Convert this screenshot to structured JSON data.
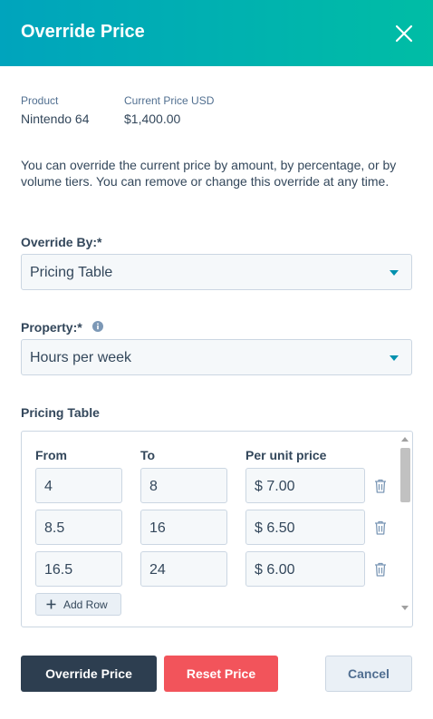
{
  "dialog": {
    "title": "Override Price",
    "close_icon": "close-icon"
  },
  "product": {
    "label": "Product",
    "value": "Nintendo 64",
    "price_label": "Current Price USD",
    "price_value": "$1,400.00"
  },
  "description": "You can override the current price by amount, by percentage, or by volume tiers. You can remove or change this override at any time.",
  "override_by": {
    "label": "Override By:*",
    "value": "Pricing Table"
  },
  "property": {
    "label": "Property:*",
    "value": "Hours per week",
    "info_icon": "info-icon"
  },
  "pricing_table": {
    "label": "Pricing Table",
    "columns": [
      "From",
      "To",
      "Per unit price"
    ],
    "rows": [
      {
        "from": "4",
        "to": "8",
        "price": "$ 7.00"
      },
      {
        "from": "8.5",
        "to": "16",
        "price": "$ 6.50"
      },
      {
        "from": "16.5",
        "to": "24",
        "price": "$ 6.00"
      }
    ],
    "add_row_label": "Add Row",
    "row_action_icon": "trash-icon"
  },
  "buttons": {
    "override": "Override Price",
    "reset": "Reset Price",
    "cancel": "Cancel"
  },
  "colors": {
    "header_start": "#00a4bd",
    "header_end": "#00bda5",
    "primary": "#2d3e50",
    "danger": "#f2545b",
    "accent": "#0091ae"
  }
}
